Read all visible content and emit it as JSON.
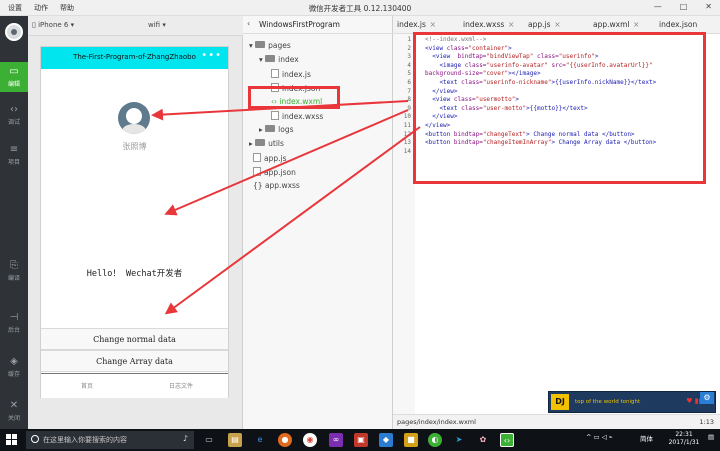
{
  "window": {
    "menu": [
      "设置",
      "动作",
      "帮助"
    ],
    "title": "微信开发者工具 0.12.130400",
    "controls": [
      "—",
      "□",
      "✕"
    ]
  },
  "rail": {
    "items": [
      {
        "label": "编辑",
        "icon": "code-icon"
      },
      {
        "label": "调试",
        "icon": "debug-icon"
      },
      {
        "label": "项目",
        "icon": "project-icon"
      },
      {
        "label": "编译",
        "icon": "compile-icon"
      },
      {
        "label": "后台",
        "icon": "backend-icon"
      },
      {
        "label": "缓存",
        "icon": "cache-icon"
      },
      {
        "label": "关闭",
        "icon": "close-icon"
      }
    ]
  },
  "simulator": {
    "device": "iPhone 6",
    "network": "wifi",
    "nav_title": "The-First-Program-of-ZhangZhaobo",
    "nav_dots": "•••",
    "nickname": "张照博",
    "motto": "Hello！ Wechat开发者",
    "buttons": [
      "Change normal data",
      "Change Array data"
    ],
    "tabs": [
      "首页",
      "日志文件"
    ]
  },
  "tree": {
    "project": "WindowsFirstProgram",
    "nodes": [
      "pages",
      "index",
      "index.js",
      "index.json",
      "index.wxml",
      "index.wxss",
      "logs",
      "utils",
      "app.js",
      "app.json",
      "app.wxss"
    ]
  },
  "editor": {
    "tabs": [
      "index.js",
      "index.wxss",
      "app.js",
      "app.wxml",
      "index.json"
    ],
    "line_numbers": [
      "1",
      "2",
      "3",
      "4",
      "5",
      "6",
      "7",
      "8",
      "9",
      "10",
      "11",
      "12",
      "13",
      "14"
    ],
    "lines": [
      {
        "a": "<!--index.wxml-->"
      },
      {
        "a": "<view ",
        "b": "class=",
        "c": "\"container\"",
        "d": ">"
      },
      {
        "a": "  <view ",
        "b": " bindtap=",
        "c": "\"bindViewTap\"",
        "e": " class=",
        "f": "\"userinfo\"",
        "d": ">"
      },
      {
        "a": "    <image ",
        "b": "class=",
        "c": "\"userinfo-avatar\"",
        "e": " src=",
        "f": "\"{{userInfo.avatarUrl}}\""
      },
      {
        "a": "background-size=",
        "b": "",
        "c": "\"cover\"",
        "d": "></image>"
      },
      {
        "a": "    <text ",
        "b": "class=",
        "c": "\"userinfo-nickname\"",
        "d": ">{{userInfo.nickName}}</text>"
      },
      {
        "a": "  </view>"
      },
      {
        "a": "  <view ",
        "b": "class=",
        "c": "\"usermotto\"",
        "d": ">"
      },
      {
        "a": "    <text ",
        "b": "class=",
        "c": "\"user-motto\"",
        "d": ">{{motto}}</text>"
      },
      {
        "a": "  </view>"
      },
      {
        "a": "</view>"
      },
      {
        "a": "<button ",
        "b": "bindtap=",
        "c": "\"changeText\"",
        "d": "> Change normal data </button>"
      },
      {
        "a": "<button ",
        "b": "bindtap=",
        "c": "\"changeItemInArray\"",
        "d": "> Change Array data </button>"
      },
      {
        "a": ""
      }
    ],
    "status_path": "pages/index/index.wxml",
    "cursor": "1:13"
  },
  "player": {
    "logo": "DJ",
    "song": "top of the world tonight",
    "controls": "♥ ▮▮ ☰"
  },
  "taskbar": {
    "search_placeholder": "在这里输入你要搜索的内容",
    "tray_lang": "简体",
    "time": "22:31",
    "date": "2017/1/31"
  },
  "colors": {
    "accent": "#3cb034",
    "nav": "#00e5ee",
    "annotation": "#e8363b",
    "rail": "#2f3337"
  }
}
